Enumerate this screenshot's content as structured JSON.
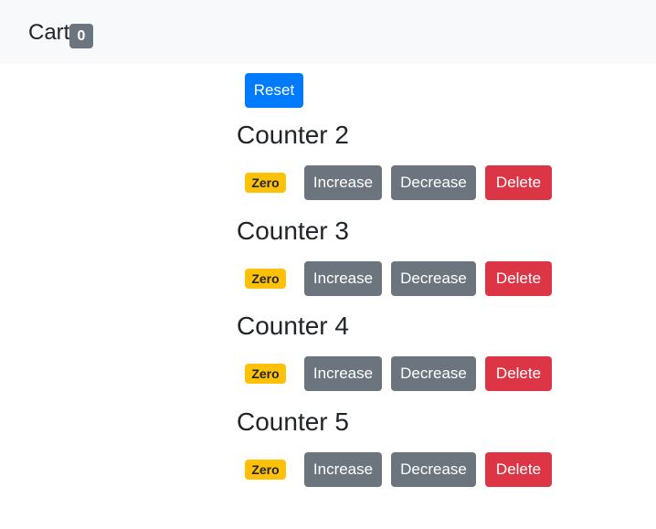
{
  "navbar": {
    "brand": "Cart",
    "cart_count": "0",
    "badge_color": "#6c757d"
  },
  "reset_label": "Reset",
  "counters": [
    {
      "title": "Counter 2",
      "badge": "Zero",
      "increase": "Increase",
      "decrease": "Decrease",
      "delete": "Delete"
    },
    {
      "title": "Counter 3",
      "badge": "Zero",
      "increase": "Increase",
      "decrease": "Decrease",
      "delete": "Delete"
    },
    {
      "title": "Counter 4",
      "badge": "Zero",
      "increase": "Increase",
      "decrease": "Decrease",
      "delete": "Delete"
    },
    {
      "title": "Counter 5",
      "badge": "Zero",
      "increase": "Increase",
      "decrease": "Decrease",
      "delete": "Delete"
    }
  ],
  "colors": {
    "primary": "#007bff",
    "secondary": "#6c757d",
    "danger": "#dc3545",
    "warning": "#ffc107",
    "navbar_bg": "#f8f9fa"
  }
}
